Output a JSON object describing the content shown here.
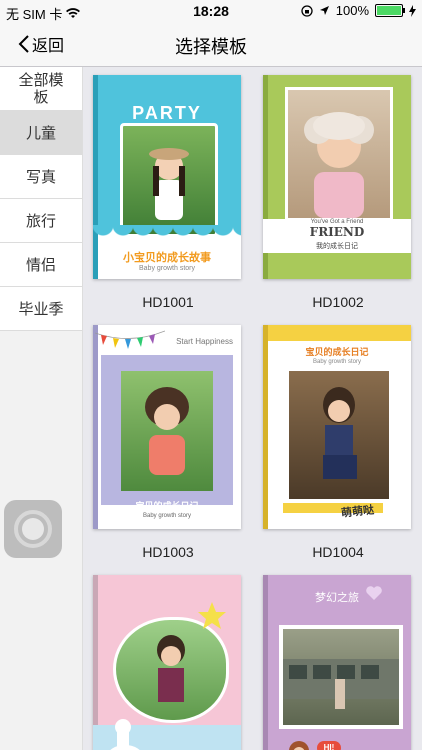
{
  "status": {
    "carrier": "无 SIM 卡",
    "time": "18:28",
    "battery": "100%"
  },
  "nav": {
    "back_label": "返回",
    "title": "选择模板"
  },
  "sidebar": {
    "items": [
      {
        "label": "全部模板"
      },
      {
        "label": "儿童"
      },
      {
        "label": "写真"
      },
      {
        "label": "旅行"
      },
      {
        "label": "情侣"
      },
      {
        "label": "毕业季"
      }
    ],
    "active_index": 1
  },
  "templates": [
    {
      "code": "HD1001",
      "heading": "PARTY",
      "subheading": "小宝贝的成长故事",
      "tagline": "Baby growth story",
      "accent": "#4fc3dc"
    },
    {
      "code": "HD1002",
      "heading": "FRIEND",
      "subheading": "我的成长日记",
      "tagline": "You've Got a Friend",
      "accent": "#a9c95a"
    },
    {
      "code": "HD1003",
      "heading": "Start Happiness",
      "subheading": "宝贝的成长日记",
      "tagline": "Baby growth story",
      "accent": "#b8b6e0"
    },
    {
      "code": "HD1004",
      "heading": "宝贝的成长日记",
      "subheading": "萌萌哒",
      "tagline": "Baby growth story",
      "accent": "#f5d142"
    },
    {
      "code": "",
      "heading": "",
      "subheading": "",
      "tagline": "",
      "accent": "#f6c6d6"
    },
    {
      "code": "",
      "heading": "梦幻之旅",
      "subheading": "HI!",
      "tagline": "",
      "accent": "#c9a5d2"
    }
  ]
}
